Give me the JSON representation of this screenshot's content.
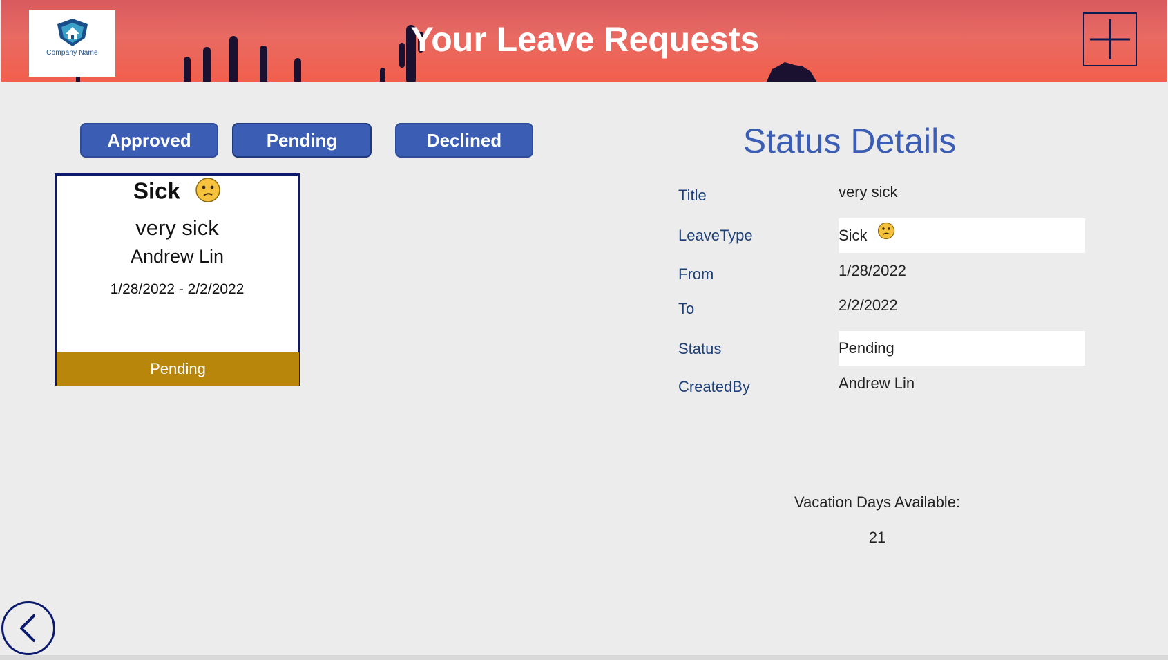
{
  "header": {
    "title": "Your Leave Requests",
    "logo_text": "Company Name"
  },
  "filters": {
    "approved": "Approved",
    "pending": "Pending",
    "declined": "Declined"
  },
  "card": {
    "leave_type": "Sick",
    "title": "very sick",
    "name": "Andrew Lin",
    "dates": "1/28/2022 - 2/2/2022",
    "status": "Pending",
    "status_color": "#b8860b"
  },
  "details": {
    "heading": "Status Details",
    "rows": [
      {
        "label": "Title",
        "value": "very sick"
      },
      {
        "label": "LeaveType",
        "value": "Sick"
      },
      {
        "label": "From",
        "value": "1/28/2022"
      },
      {
        "label": "To",
        "value": "2/2/2022"
      },
      {
        "label": "Status",
        "value": "Pending"
      },
      {
        "label": "CreatedBy",
        "value": "Andrew Lin"
      }
    ]
  },
  "vacation": {
    "label": "Vacation Days Available:",
    "value": "21"
  },
  "colors": {
    "accent": "#3b5db3",
    "dark_navy": "#0b1a6e",
    "pending": "#b8860b"
  },
  "icons": {
    "emoji": "confused-face-icon",
    "add": "plus-icon",
    "back": "chevron-left-icon",
    "logo": "house-shield-icon"
  }
}
